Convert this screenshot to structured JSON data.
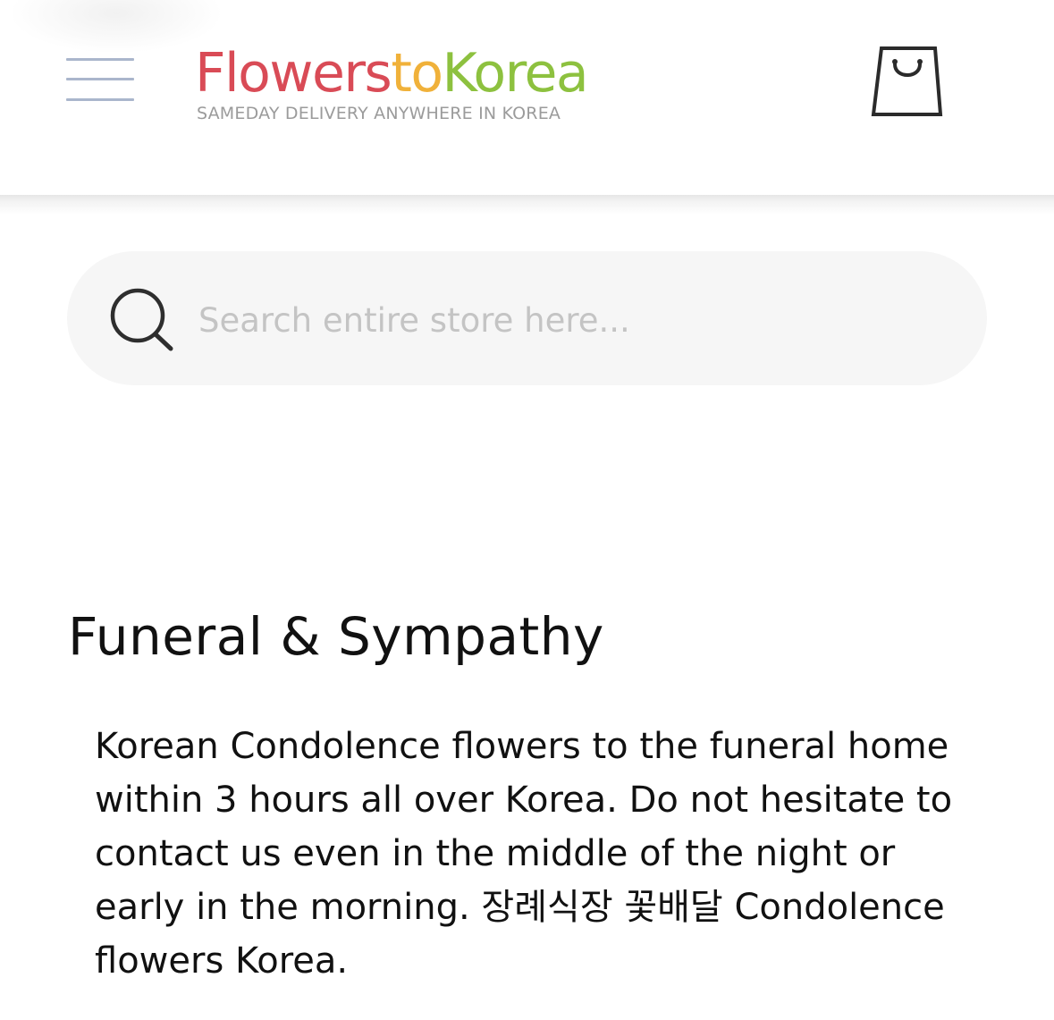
{
  "header": {
    "menu_icon": "hamburger-menu-icon",
    "logo": {
      "flowers": "Flowers",
      "to": "to",
      "korea": "Korea",
      "tagline": "SAMEDAY DELIVERY ANYWHERE IN KOREA",
      "colors": {
        "flowers": "#d94b56",
        "to": "#f0b13a",
        "korea": "#8dc13f",
        "tagline": "#9b9b9b"
      }
    },
    "cart_icon": "shopping-bag-icon"
  },
  "search": {
    "icon": "search-icon",
    "placeholder": "Search entire store here...",
    "value": ""
  },
  "category": {
    "title": "Funeral & Sympathy",
    "description": "Korean Condolence flowers to the funeral home within 3 hours all over Korea. Do not hesitate to contact us even in the middle of the night or early in the morning. 장례식장 꽃배달 Condolence flowers Korea."
  }
}
